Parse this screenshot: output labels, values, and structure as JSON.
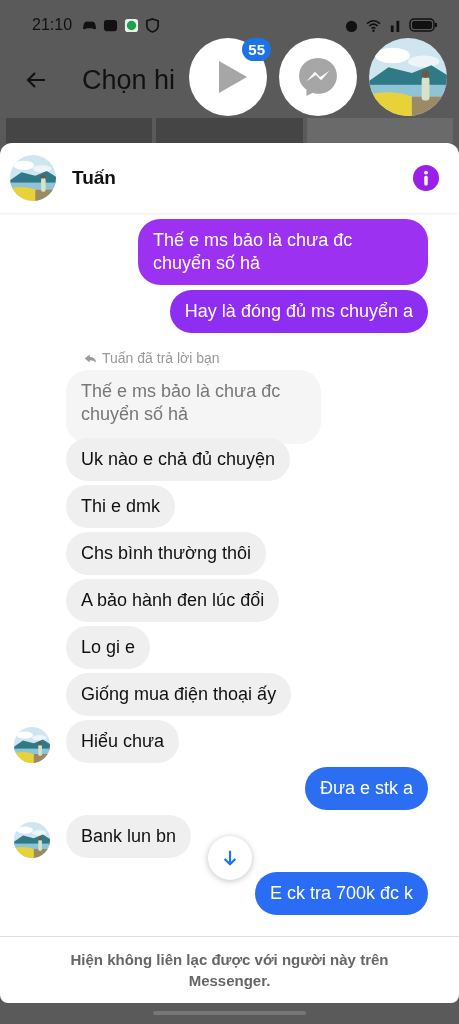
{
  "status_bar": {
    "time": "21:10"
  },
  "background_app": {
    "title": "Chọn hi"
  },
  "chat_heads": {
    "badge": "55"
  },
  "chat": {
    "contact": "Tuấn",
    "messages": [
      {
        "kind": "sent",
        "text": "Thế e ms bảo là chưa đc chuyển số hả",
        "color": "#9d31f2"
      },
      {
        "kind": "sent",
        "text": "Hay là đóng đủ ms chuyển a",
        "color": "#8f2ef3"
      },
      {
        "kind": "reply_note",
        "text": "Tuấn đã trả lời bạn"
      },
      {
        "kind": "quoted",
        "text": "Thế e ms bảo là chưa đc chuyển số hả"
      },
      {
        "kind": "received",
        "text": "Uk nào e chả đủ chuyện",
        "avatar": false
      },
      {
        "kind": "received",
        "text": "Thi e dmk",
        "avatar": false
      },
      {
        "kind": "received",
        "text": "Chs bình thường thôi",
        "avatar": false
      },
      {
        "kind": "received",
        "text": "A bảo hành đen lúc đổi",
        "avatar": false
      },
      {
        "kind": "received",
        "text": "Lo gi e",
        "avatar": false
      },
      {
        "kind": "received",
        "text": "Giống mua điện thoại ấy",
        "avatar": false
      },
      {
        "kind": "received",
        "text": "Hiểu chưa",
        "avatar": true
      },
      {
        "kind": "sent",
        "text": "Đưa e stk a",
        "color": "#2b6ef2"
      },
      {
        "kind": "received",
        "text": "Bank lun bn",
        "avatar": true
      },
      {
        "kind": "sent",
        "text": "E ck tra 700k đc k",
        "color": "#2a6cf3"
      }
    ]
  },
  "footer": "Hiện không liên lạc được với người này trên Messenger."
}
